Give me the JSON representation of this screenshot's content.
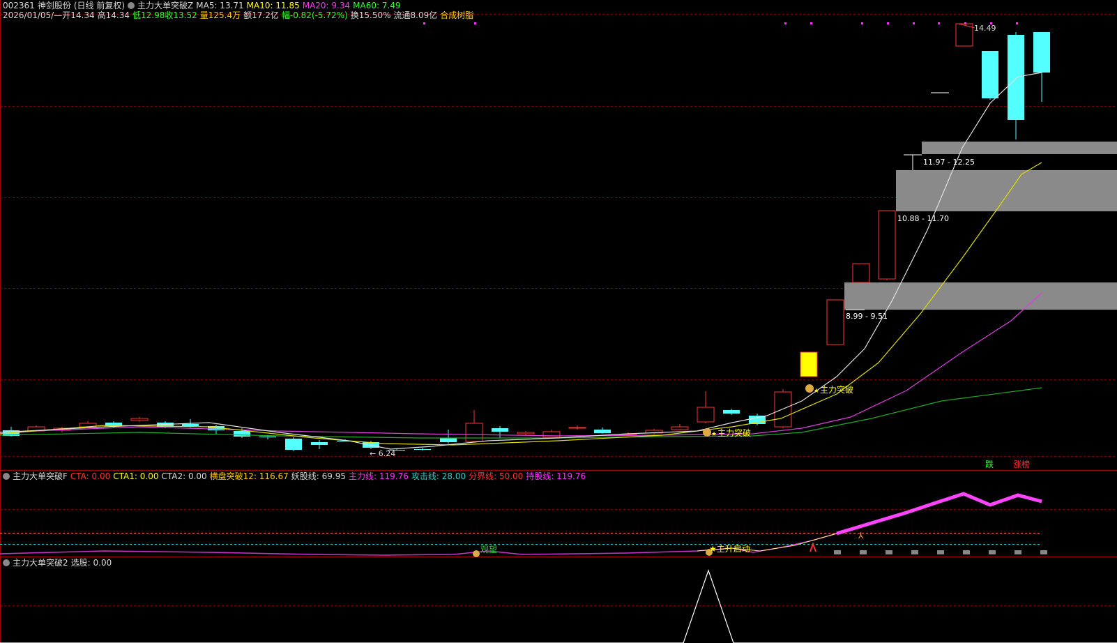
{
  "main_header": {
    "code": "002361",
    "name": "神剑股份",
    "period": "(日线 前复权)",
    "indicator": "主力大单突破Z",
    "ma5": "MA5: 13.71",
    "ma10": "MA10: 11.85",
    "ma20": "MA20: 9.34",
    "ma60": "MA60: 7.49"
  },
  "info_bar": {
    "date": "2026/01/05/—",
    "open_label": "开",
    "open": "14.34",
    "high_label": "高",
    "high": "14.34",
    "low_label": "低",
    "low": "12.98",
    "close_label": "收",
    "close": "13.52",
    "vol_label": "量",
    "vol": "125.4万",
    "amount_label": "额",
    "amount": "17.2亿",
    "change_label": "幅",
    "change": "-0.82(-5.72%)",
    "turnover_label": "换",
    "turnover": "15.50%",
    "float_label": "流通",
    "float": "8.09亿",
    "sector": "合成树脂"
  },
  "price_labels": {
    "high_mark": "14.49",
    "low_mark": "6.24",
    "zone1": "11.97 - 12.25",
    "zone2": "10.88 - 11.70",
    "zone3": "8.99 - 9.51",
    "signal1": "主力突破",
    "signal2": "主力突破"
  },
  "bottom_tags": {
    "tag1": "跌",
    "tag2": "涨榜"
  },
  "sub1_header": {
    "name": "主力大单突破F",
    "cta": "CTA: 0.00",
    "cta1": "CTA1: 0.00",
    "cta2": "CTA2: 0.00",
    "hp": "横盘突破12: 116.67",
    "yg": "妖股线: 69.95",
    "zl": "主力线: 119.76",
    "gj": "攻击线: 28.00",
    "fj": "分界线: 50.00",
    "cg": "持股线: 119.76"
  },
  "sub1_labels": {
    "wait": "观望",
    "start": "主升启动"
  },
  "sub2_header": {
    "name": "主力大单突破2",
    "xg": "选股: 0.00"
  },
  "colors": {
    "up": "#ff3333",
    "down": "#54ffff",
    "ma5": "#ffffff",
    "ma10": "#ffff00",
    "ma20": "#ff33ff",
    "ma60": "#33cc33",
    "zone": "#888888",
    "grid": "#8b0000"
  }
}
